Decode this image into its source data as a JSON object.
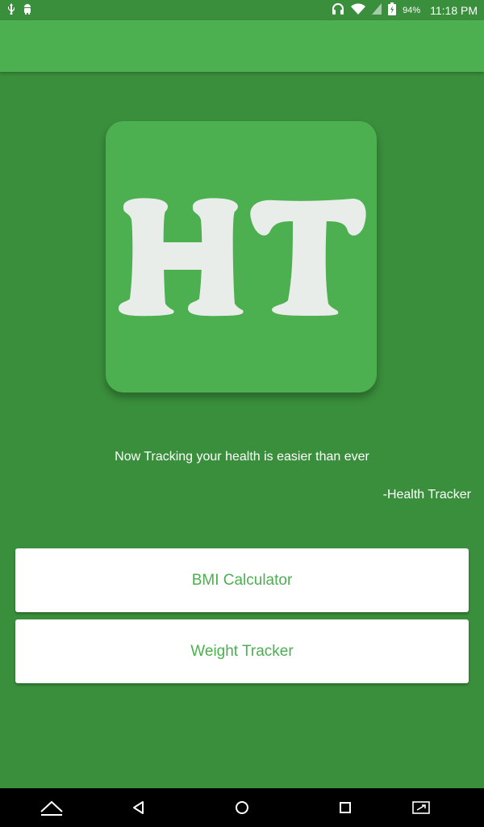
{
  "status_bar": {
    "battery_percent": "94%",
    "time": "11:18 PM",
    "left_icons": [
      "usb-icon",
      "android-debug-icon"
    ],
    "right_icons": [
      "headset-icon",
      "wifi-icon",
      "battery-icon"
    ]
  },
  "logo": {
    "text": "HT",
    "tile_color": "#4caf50",
    "letter_color": "#e8ede9"
  },
  "tagline": "Now Tracking your health is easier than ever",
  "signature": "-Health Tracker",
  "buttons": {
    "bmi_label": "BMI Calculator",
    "weight_label": "Weight Tracker"
  },
  "nav_bar": {
    "icons": [
      "home-up-icon",
      "back-icon",
      "home-icon",
      "recents-icon",
      "screenshot-icon"
    ]
  },
  "colors": {
    "background": "#3a8f3c",
    "app_bar": "#4caf50",
    "accent_text": "#4caf50"
  }
}
